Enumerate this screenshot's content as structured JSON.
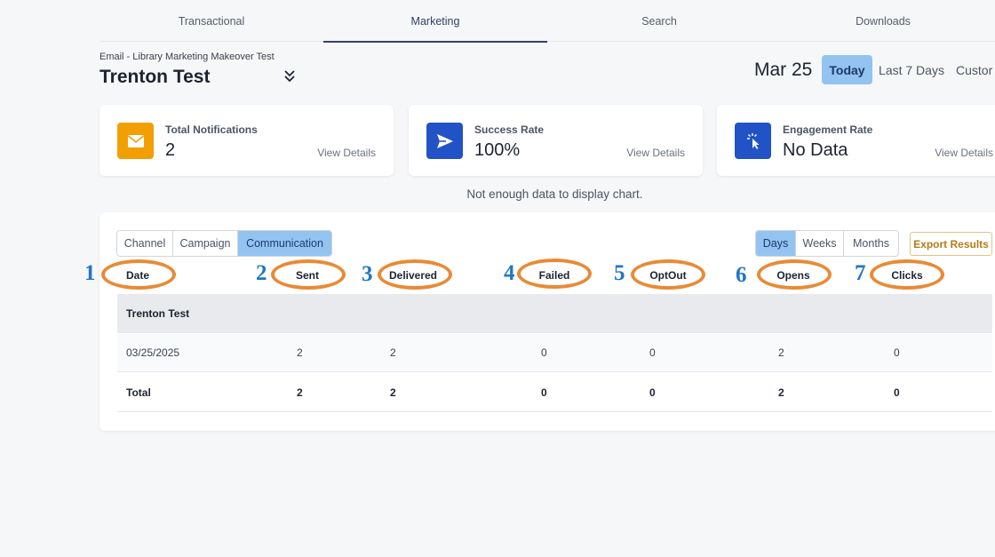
{
  "nav": {
    "tabs": [
      "Transactional",
      "Marketing",
      "Search",
      "Downloads"
    ]
  },
  "header": {
    "breadcrumb": "Email - Library Marketing Makeover Test",
    "title": "Trenton Test",
    "date_label": "Mar 25",
    "ranges": [
      "Today",
      "Last 7 Days",
      "Custor"
    ]
  },
  "cards": [
    {
      "label": "Total Notifications",
      "value": "2",
      "link": "View Details",
      "icon": "envelope-icon",
      "color": "#f29f05"
    },
    {
      "label": "Success Rate",
      "value": "100%",
      "link": "View Details",
      "icon": "send-icon",
      "color": "#2153c6"
    },
    {
      "label": "Engagement Rate",
      "value": "No Data",
      "link": "View Details",
      "icon": "click-icon",
      "color": "#2153c6"
    }
  ],
  "chart_message": "Not enough data to display chart.",
  "view_tabs": [
    "Channel",
    "Campaign",
    "Communication"
  ],
  "period_tabs": [
    "Days",
    "Weeks",
    "Months"
  ],
  "export_label": "Export Results",
  "columns": [
    "Date",
    "Sent",
    "Delivered",
    "Failed",
    "OptOut",
    "Opens",
    "Clicks"
  ],
  "markers": [
    "1",
    "2",
    "3",
    "4",
    "5",
    "6",
    "7"
  ],
  "table": {
    "group": "Trenton Test",
    "rows": [
      [
        "03/25/2025",
        "2",
        "2",
        "0",
        "0",
        "2",
        "0"
      ]
    ],
    "total": [
      "Total",
      "2",
      "2",
      "0",
      "0",
      "2",
      "0"
    ]
  },
  "accent_color": "#93c3f1",
  "annotation_color": "#e98a35"
}
